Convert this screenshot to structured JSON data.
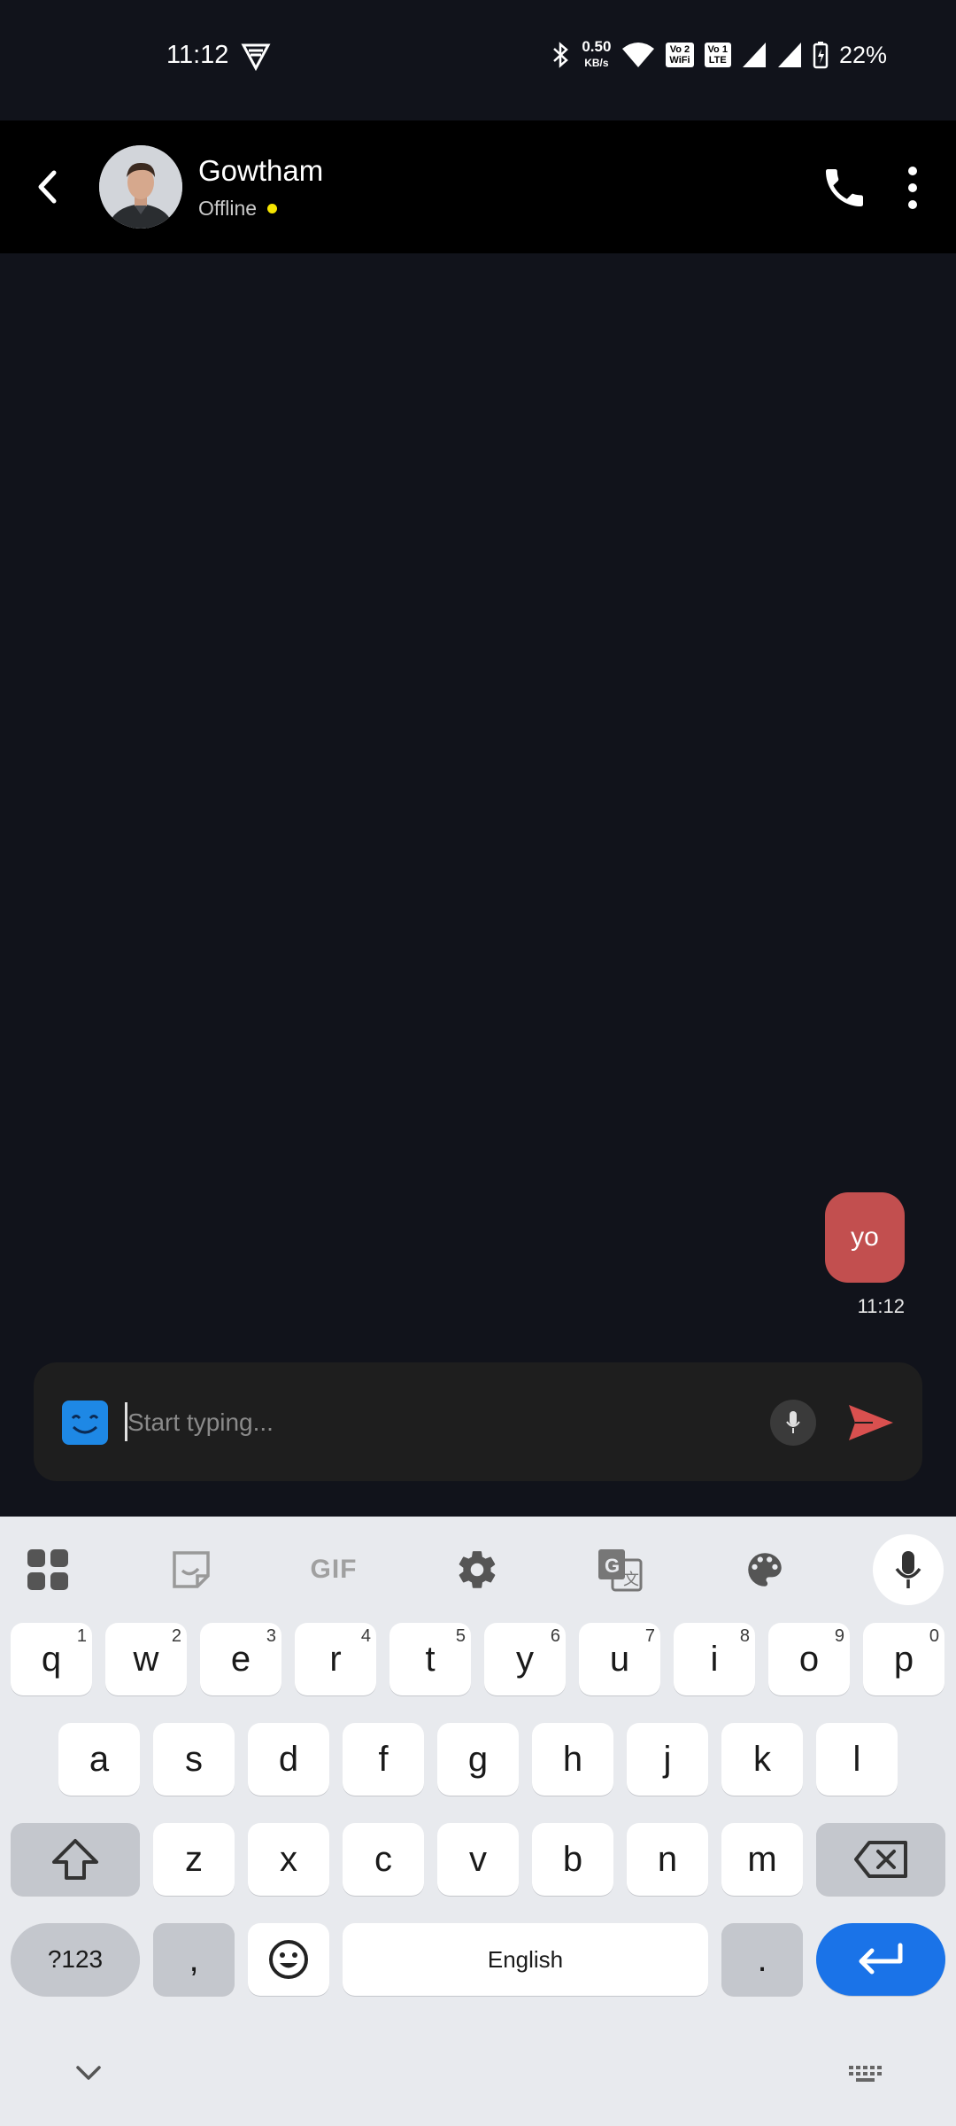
{
  "status_bar": {
    "time": "11:12",
    "net_speed": "0.50",
    "net_unit": "KB/s",
    "sim1_badge_top": "Vo 2",
    "sim1_badge_bottom": "WiFi",
    "sim2_badge_top": "Vo 1",
    "sim2_badge_bottom": "LTE",
    "battery": "22%",
    "icons": [
      "vpn-icon",
      "bluetooth-icon",
      "wifi-icon",
      "signal-icon",
      "battery-charging-icon"
    ]
  },
  "header": {
    "contact_name": "Gowtham",
    "status_text": "Offline",
    "status_color": "#f5e400"
  },
  "messages": [
    {
      "text": "yo",
      "time": "11:12",
      "direction": "outgoing",
      "bubble_color": "#c24f4f"
    }
  ],
  "composer": {
    "placeholder": "Start typing...",
    "value": ""
  },
  "keyboard": {
    "toolbar": [
      "apps-icon",
      "sticker-icon",
      "gif-icon",
      "settings-icon",
      "translate-icon",
      "palette-icon",
      "mic-icon"
    ],
    "gif_label": "GIF",
    "row1": [
      {
        "k": "q",
        "n": "1"
      },
      {
        "k": "w",
        "n": "2"
      },
      {
        "k": "e",
        "n": "3"
      },
      {
        "k": "r",
        "n": "4"
      },
      {
        "k": "t",
        "n": "5"
      },
      {
        "k": "y",
        "n": "6"
      },
      {
        "k": "u",
        "n": "7"
      },
      {
        "k": "i",
        "n": "8"
      },
      {
        "k": "o",
        "n": "9"
      },
      {
        "k": "p",
        "n": "0"
      }
    ],
    "row2": [
      "a",
      "s",
      "d",
      "f",
      "g",
      "h",
      "j",
      "k",
      "l"
    ],
    "row3": [
      "z",
      "x",
      "c",
      "v",
      "b",
      "n",
      "m"
    ],
    "sym_label": "?123",
    "comma": ",",
    "space_label": "English",
    "period": ".",
    "accent_color": "#1a73e8"
  }
}
